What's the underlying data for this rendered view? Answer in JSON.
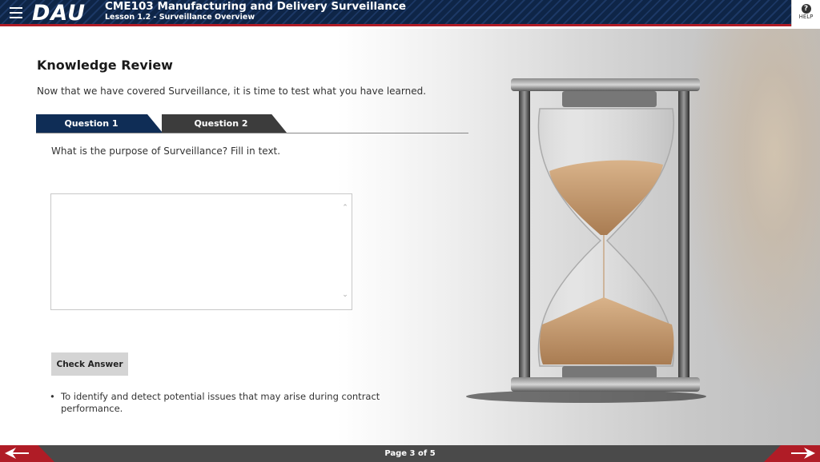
{
  "header": {
    "logo": "DAU",
    "course_title": "CME103 Manufacturing and Delivery Surveillance",
    "lesson_title": "Lesson 1.2 - Surveillance Overview",
    "help_label": "HELP",
    "help_glyph": "?"
  },
  "content": {
    "title": "Knowledge Review",
    "intro": "Now that we have covered Surveillance, it is time to test what you have learned.",
    "tabs": [
      {
        "label": "Question 1",
        "active": true
      },
      {
        "label": "Question 2",
        "active": false
      }
    ],
    "question": "What is the purpose of Surveillance? Fill in text.",
    "answer_value": "",
    "check_button": "Check Answer",
    "feedback": [
      "To identify and detect potential issues that may arise during contract performance."
    ]
  },
  "footer": {
    "page_label": "Page 3 of 5"
  },
  "colors": {
    "header_navy": "#0e2547",
    "accent_red": "#b01c26",
    "tab_active": "#0f2d56",
    "tab_inactive": "#3c3c3c",
    "footer_gray": "#4a4a4a"
  },
  "icons": {
    "menu": "hamburger-icon",
    "help": "question-circle-icon",
    "prev": "arrow-left-icon",
    "next": "arrow-right-icon"
  }
}
